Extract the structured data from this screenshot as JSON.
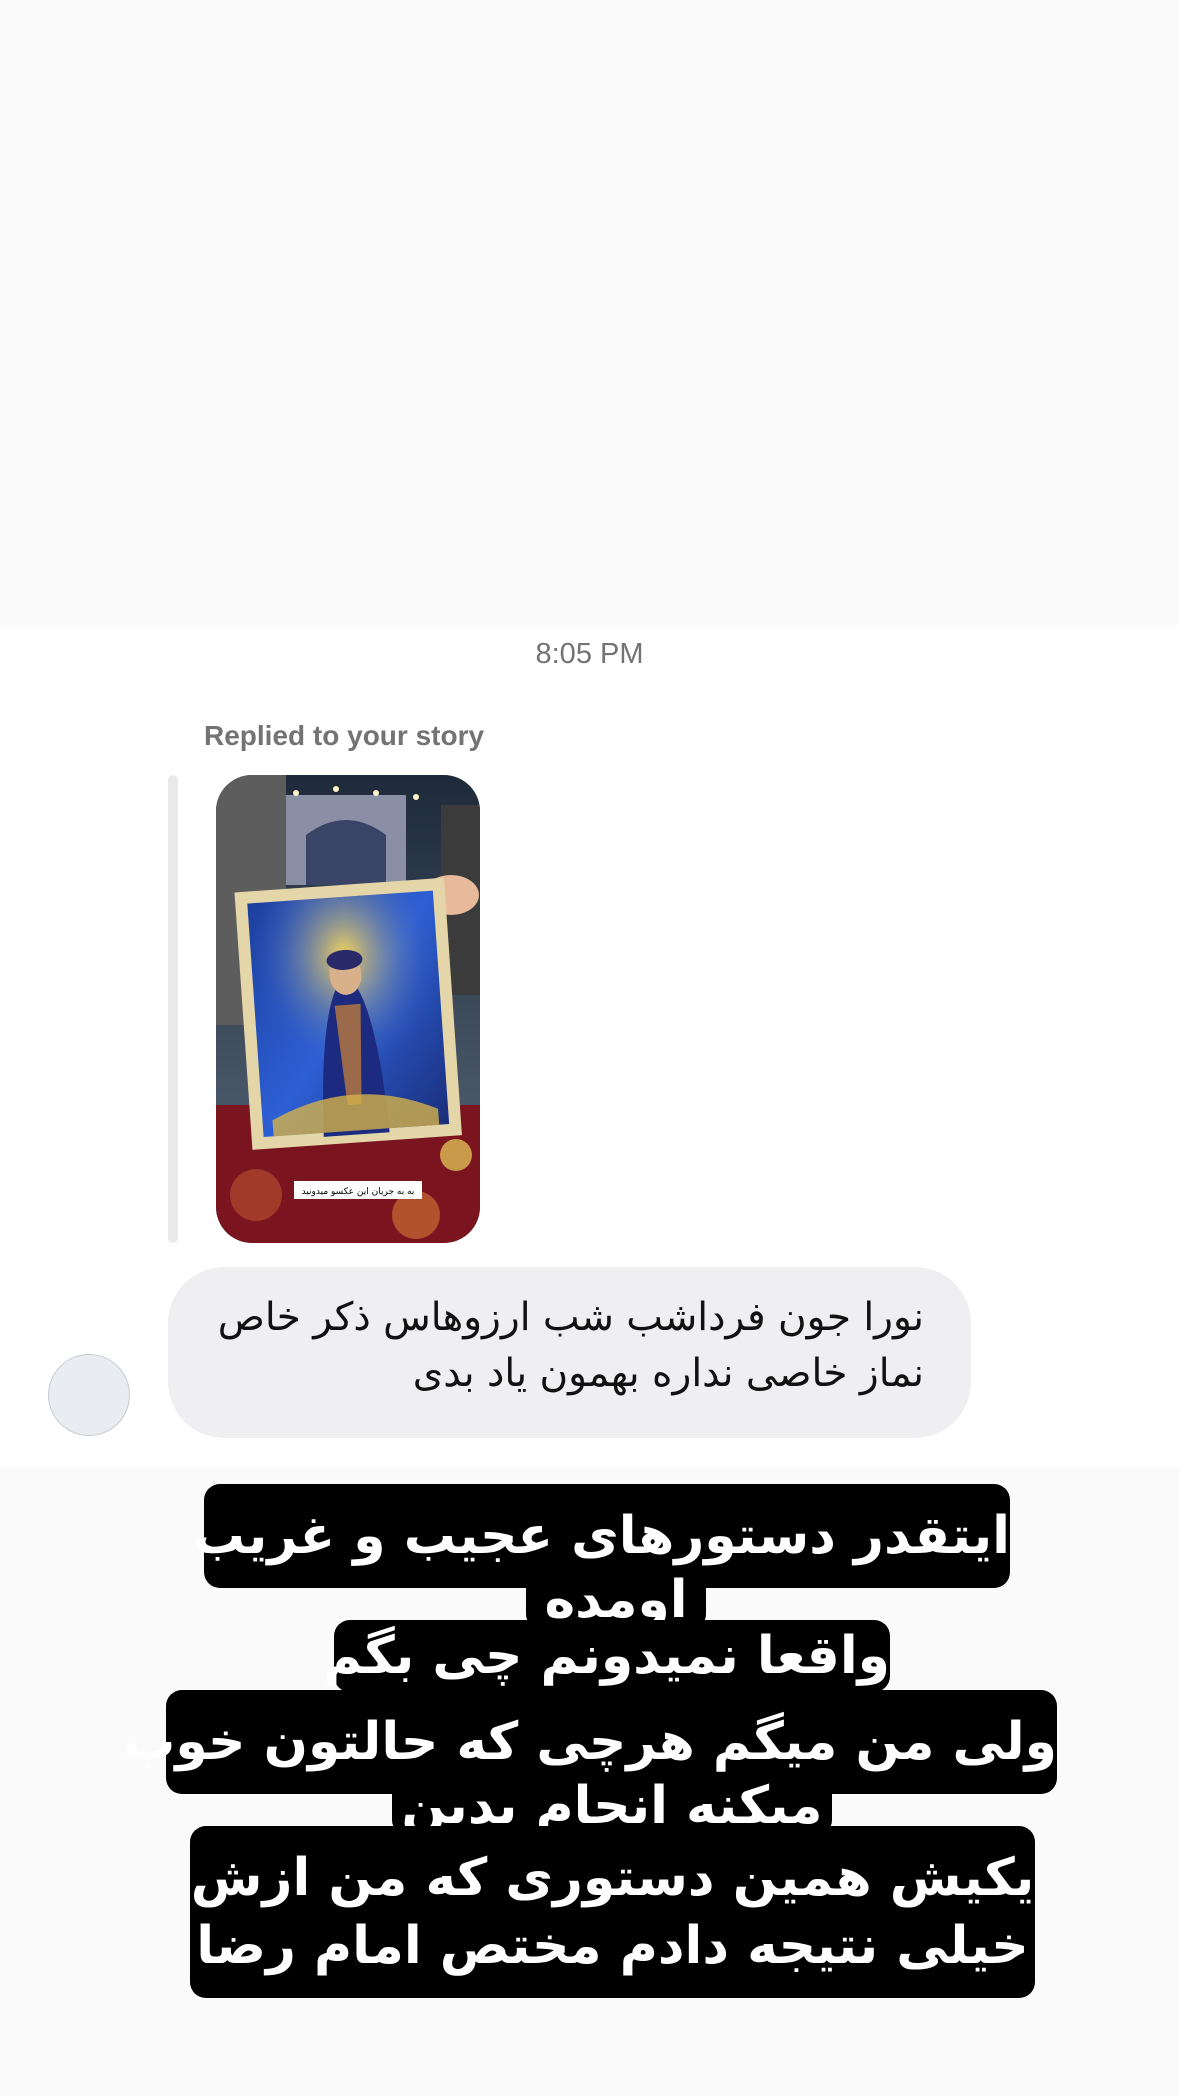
{
  "message": {
    "timestamp": "8:05 PM",
    "reply_label": "Replied to your story",
    "story_caption": "به به جریان این عکسو میدونید",
    "text": "نورا جون فرداشب شب ارزوهاس ذکر خاص\nنماز خاصی نداره بهمون یاد بدی"
  },
  "caption": {
    "lines": [
      "ایتقدر دستورهای عجیب و غریب",
      "اومده",
      "واقعا نمیدونم چی بگم",
      "ولی من میگم هرچی که حالتون خوب",
      "میکنه انجام بدین",
      "یکیش همین دستوری که من ازش",
      "خیلی نتیجه دادم مختص امام رضا"
    ]
  },
  "colors": {
    "page_bg": "#fafafa",
    "chat_bg": "#ffffff",
    "bubble_bg": "#efeff1",
    "caption_bg": "#000000",
    "caption_text": "#ffffff"
  }
}
